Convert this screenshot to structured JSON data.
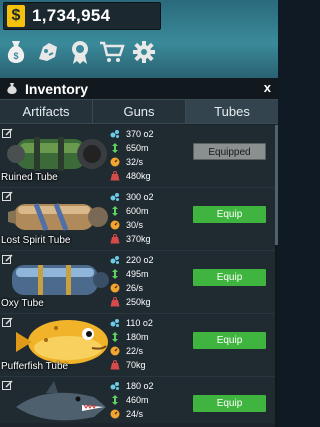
{
  "hud": {
    "currency_symbol": "$",
    "money": "1,734,954",
    "icons": [
      "money-bag-icon",
      "pet-icon",
      "badge-icon",
      "cart-icon",
      "gear-icon"
    ]
  },
  "inventory": {
    "title": "Inventory",
    "close_label": "x",
    "tabs": [
      {
        "label": "Artifacts",
        "active": false
      },
      {
        "label": "Guns",
        "active": false
      },
      {
        "label": "Tubes",
        "active": true
      }
    ],
    "items": [
      {
        "name": "Ruined Tube",
        "oxygen": "370 o2",
        "depth": "650m",
        "speed": "32/s",
        "weight": "480kg",
        "button": "Equipped",
        "equipped": true
      },
      {
        "name": "Lost Spirit Tube",
        "oxygen": "300 o2",
        "depth": "600m",
        "speed": "30/s",
        "weight": "370kg",
        "button": "Equip",
        "equipped": false
      },
      {
        "name": "Oxy Tube",
        "oxygen": "220 o2",
        "depth": "495m",
        "speed": "26/s",
        "weight": "250kg",
        "button": "Equip",
        "equipped": false
      },
      {
        "name": "Pufferfish Tube",
        "oxygen": "110 o2",
        "depth": "180m",
        "speed": "22/s",
        "weight": "70kg",
        "button": "Equip",
        "equipped": false
      },
      {
        "name": "",
        "oxygen": "180 o2",
        "depth": "460m",
        "speed": "24/s",
        "weight": "",
        "button": "Equip",
        "equipped": false
      }
    ]
  },
  "colors": {
    "hud_teal": "#3a8a9a",
    "equip_green": "#3fb53f",
    "equipped_gray": "#8a8f90",
    "panel_bg": "#1c252c",
    "money_gold": "#f4c20d"
  }
}
